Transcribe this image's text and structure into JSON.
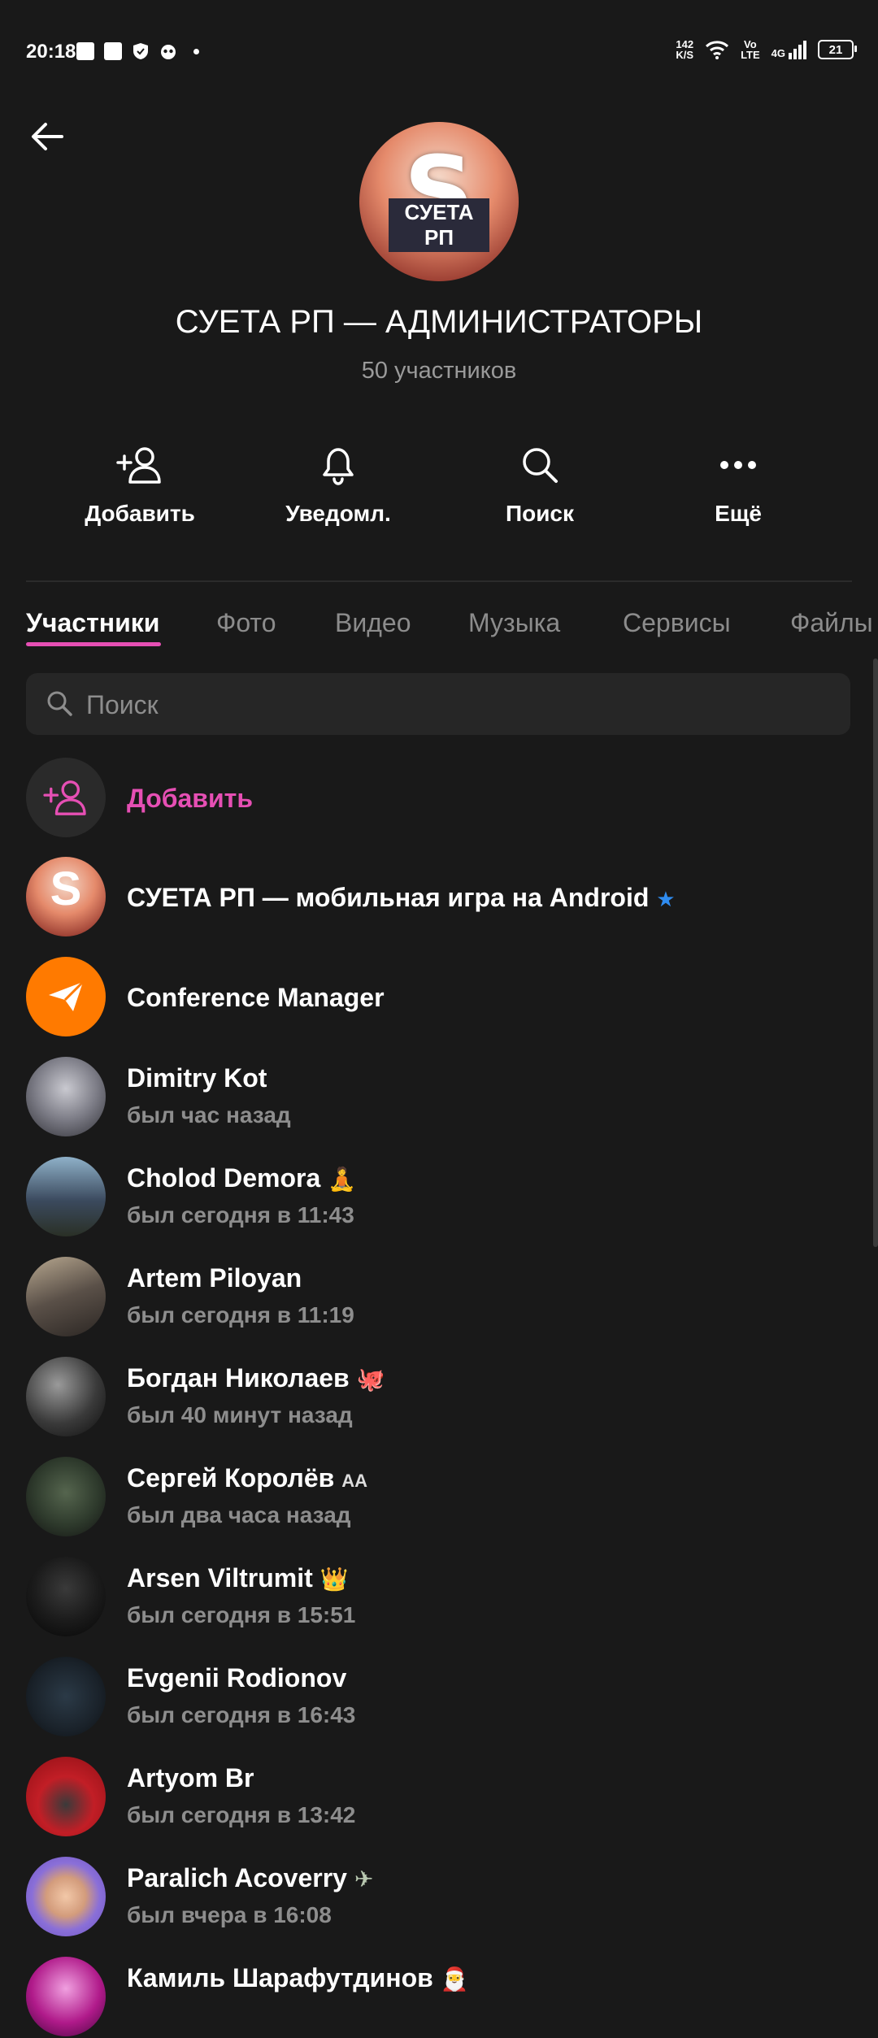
{
  "status_bar": {
    "time": "20:18",
    "net_speed_top": "142",
    "net_speed_bottom": "K/S",
    "volte_top": "Vo",
    "volte_bottom": "LTE",
    "network": "4G",
    "battery": "21"
  },
  "group": {
    "title": "СУЕТА РП — АДМИНИСТРАТОРЫ",
    "subtitle": "50 участников",
    "avatar_caption": "СУЕТА РП",
    "avatar_letter": "S"
  },
  "actions": [
    {
      "label": "Добавить",
      "icon": "add-user-icon"
    },
    {
      "label": "Уведомл.",
      "icon": "bell-icon"
    },
    {
      "label": "Поиск",
      "icon": "search-icon"
    },
    {
      "label": "Ещё",
      "icon": "more-dots-icon"
    }
  ],
  "tabs": [
    "Участники",
    "Фото",
    "Видео",
    "Музыка",
    "Сервисы",
    "Файлы"
  ],
  "search": {
    "placeholder": "Поиск"
  },
  "add_member": {
    "label": "Добавить"
  },
  "members": [
    {
      "name": "СУЕТА РП — мобильная игра на Android",
      "status": "",
      "badge": "★",
      "avatar_color": "#c8604b"
    },
    {
      "name": "Conference Manager",
      "status": "",
      "badge": "",
      "avatar_color": "#ff7a00"
    },
    {
      "name": "Dimitry Kot",
      "status": "был час назад",
      "badge": "",
      "avatar_color": "#6e6e78"
    },
    {
      "name": "Cholod Demora",
      "status": "был сегодня в 11:43",
      "badge": "🧘",
      "avatar_color": "#3b4a5e"
    },
    {
      "name": "Artem Piloyan",
      "status": "был сегодня в 11:19",
      "badge": "",
      "avatar_color": "#5a5048"
    },
    {
      "name": "Богдан Николаев",
      "status": "был 40 минут назад",
      "badge": "🐙",
      "avatar_color": "#3a3a3a"
    },
    {
      "name": "Сергей Королёв",
      "status": "был два часа назад",
      "badge": "AA",
      "avatar_color": "#2e3a2c"
    },
    {
      "name": "Arsen Viltrumit",
      "status": "был сегодня в 15:51",
      "badge": "👑",
      "avatar_color": "#1c1c1c"
    },
    {
      "name": "Evgenii Rodionov",
      "status": "был сегодня в 16:43",
      "badge": "",
      "avatar_color": "#1f2a33"
    },
    {
      "name": "Artyom Br",
      "status": "был сегодня в 13:42",
      "badge": "",
      "avatar_color": "#c21e26"
    },
    {
      "name": "Paralich Acoverry",
      "status": "был вчера в 16:08",
      "badge": "✈",
      "avatar_color": "#8a6fd8"
    },
    {
      "name": "Камиль Шарафутдинов",
      "status": "",
      "badge": "🎅",
      "avatar_color": "#b01a8a"
    }
  ]
}
